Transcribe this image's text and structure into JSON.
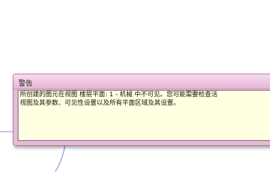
{
  "dialog": {
    "title": "警告",
    "message_line1": "所创建的图元在视图 楼层平面: 1 - 机械 中不可见。您可能需要检查活",
    "message_line2": "视图及其参数、可见性设置以及所有平面区域及其设置。"
  },
  "colors": {
    "dialog_frame": "#e9b9d8",
    "message_background": "#ffffe1",
    "background_line": "#8a8ee0"
  }
}
